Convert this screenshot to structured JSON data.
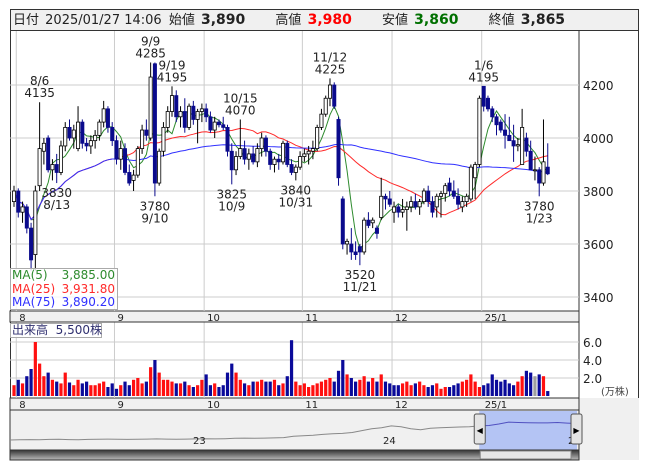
{
  "header": {
    "date_label": "日付",
    "datetime": "2025/01/27 14:06",
    "open_label": "始値",
    "open": "3,890",
    "high_label": "高値",
    "high": "3,980",
    "low_label": "安値",
    "low": "3,860",
    "close_label": "終値",
    "close": "3,865"
  },
  "ma_legend": [
    {
      "label": "MA(5)",
      "value": "3,885.00",
      "color": "#2e8b2e"
    },
    {
      "label": "MA(25)",
      "value": "3,931.80",
      "color": "#ff2a2a"
    },
    {
      "label": "MA(75)",
      "value": "3,890.20",
      "color": "#3030ff"
    }
  ],
  "volume_legend": {
    "label": "出来高",
    "value": "5,500株"
  },
  "colors": {
    "up_body": "#ffffff",
    "down_body": "#0a0a8c",
    "vol_up": "#ff1010",
    "vol_down": "#0a0a9a",
    "vol_flat": "#a0a0a0",
    "ma5": "#2e8b2e",
    "ma25": "#ff2a2a",
    "ma75": "#3030ff",
    "selection": "#b4c4f4"
  },
  "chart_data": {
    "type": "candlestick",
    "price_axis": {
      "ticks": [
        4200,
        4000,
        3800,
        3600,
        3400
      ],
      "labels": [
        "4200",
        "4000",
        "3800",
        "3600",
        "3400"
      ]
    },
    "volume_axis": {
      "ticks": [
        6,
        4,
        2
      ],
      "labels": [
        "6.0",
        "4.0",
        "2.0"
      ],
      "unit": "(万株)"
    },
    "month_ticks": [
      {
        "index": 1,
        "label": "8"
      },
      {
        "index": 24,
        "label": "9"
      },
      {
        "index": 45,
        "label": "10"
      },
      {
        "index": 68,
        "label": "11"
      },
      {
        "index": 89,
        "label": "12"
      },
      {
        "index": 110,
        "label": "25/1"
      }
    ],
    "ohlc": [
      [
        3760,
        3820,
        3740,
        3800
      ],
      [
        3800,
        3810,
        3700,
        3720
      ],
      [
        3720,
        3760,
        3680,
        3740
      ],
      [
        3740,
        3750,
        3640,
        3660
      ],
      [
        3660,
        3680,
        3500,
        3540
      ],
      [
        3560,
        3820,
        3500,
        3800
      ],
      [
        3820,
        4135,
        3800,
        3960
      ],
      [
        3950,
        4000,
        3900,
        3980
      ],
      [
        4000,
        4010,
        3870,
        3880
      ],
      [
        3880,
        3920,
        3840,
        3900
      ],
      [
        3900,
        3940,
        3830,
        3870
      ],
      [
        3870,
        3990,
        3860,
        3970
      ],
      [
        3970,
        4060,
        3950,
        4040
      ],
      [
        4040,
        4070,
        3990,
        4000
      ],
      [
        4000,
        4050,
        3960,
        4030
      ],
      [
        3960,
        4120,
        3950,
        4060
      ],
      [
        4060,
        4070,
        3960,
        3980
      ],
      [
        3980,
        4000,
        3950,
        3970
      ],
      [
        3970,
        4010,
        3940,
        3990
      ],
      [
        3990,
        4030,
        3960,
        4010
      ],
      [
        4010,
        4070,
        3990,
        4060
      ],
      [
        4060,
        4140,
        4040,
        4110
      ],
      [
        4110,
        4120,
        4020,
        4040
      ],
      [
        4040,
        4060,
        3970,
        3990
      ],
      [
        3990,
        4010,
        3900,
        3920
      ],
      [
        3920,
        3990,
        3880,
        3960
      ],
      [
        3960,
        3980,
        3860,
        3870
      ],
      [
        3870,
        3900,
        3820,
        3830
      ],
      [
        3840,
        3880,
        3800,
        3860
      ],
      [
        3860,
        3970,
        3850,
        3960
      ],
      [
        3960,
        4050,
        3940,
        4030
      ],
      [
        4030,
        4070,
        3990,
        4010
      ],
      [
        4000,
        4285,
        3990,
        4230
      ],
      [
        4280,
        4285,
        3780,
        3830
      ],
      [
        3830,
        3960,
        3820,
        3950
      ],
      [
        3950,
        4060,
        3930,
        4040
      ],
      [
        4040,
        4120,
        4020,
        4100
      ],
      [
        4100,
        4195,
        4080,
        4160
      ],
      [
        4160,
        4180,
        4060,
        4080
      ],
      [
        4080,
        4120,
        4040,
        4100
      ],
      [
        4100,
        4150,
        4020,
        4040
      ],
      [
        4040,
        4130,
        4030,
        4120
      ],
      [
        4120,
        4140,
        4050,
        4070
      ],
      [
        4070,
        4110,
        3980,
        4100
      ],
      [
        4100,
        4130,
        4060,
        4110
      ],
      [
        4110,
        4130,
        4060,
        4080
      ],
      [
        4080,
        4100,
        4020,
        4030
      ],
      [
        4030,
        4080,
        4000,
        4060
      ],
      [
        4060,
        4070,
        4040,
        4050
      ],
      [
        4050,
        4080,
        4030,
        4040
      ],
      [
        4040,
        4050,
        3930,
        3950
      ],
      [
        3950,
        3980,
        3825,
        3880
      ],
      [
        3880,
        3950,
        3860,
        3930
      ],
      [
        3930,
        4070,
        3920,
        3960
      ],
      [
        3960,
        3990,
        3900,
        3920
      ],
      [
        3920,
        3960,
        3880,
        3940
      ],
      [
        3940,
        3970,
        3900,
        3910
      ],
      [
        3910,
        3980,
        3890,
        3960
      ],
      [
        3960,
        4020,
        3930,
        4000
      ],
      [
        4000,
        4010,
        3930,
        3950
      ],
      [
        3950,
        3960,
        3880,
        3900
      ],
      [
        3900,
        3930,
        3870,
        3920
      ],
      [
        3920,
        3940,
        3880,
        3910
      ],
      [
        3910,
        3990,
        3900,
        3980
      ],
      [
        3980,
        3990,
        3890,
        3900
      ],
      [
        3900,
        3920,
        3860,
        3870
      ],
      [
        3870,
        3900,
        3840,
        3890
      ],
      [
        3890,
        3950,
        3880,
        3930
      ],
      [
        3930,
        3960,
        3910,
        3940
      ],
      [
        3940,
        3970,
        3900,
        3950
      ],
      [
        3950,
        3990,
        3920,
        3960
      ],
      [
        3960,
        4050,
        3950,
        4040
      ],
      [
        4040,
        4110,
        4030,
        4090
      ],
      [
        4090,
        4160,
        4080,
        4150
      ],
      [
        4150,
        4225,
        4120,
        4200
      ],
      [
        4200,
        4210,
        4110,
        4120
      ],
      [
        4070,
        4080,
        3820,
        3850
      ],
      [
        3770,
        3780,
        3580,
        3600
      ],
      [
        3600,
        3620,
        3560,
        3610
      ],
      [
        3600,
        3660,
        3540,
        3570
      ],
      [
        3570,
        3610,
        3540,
        3560
      ],
      [
        3590,
        3600,
        3520,
        3570
      ],
      [
        3570,
        3700,
        3560,
        3690
      ],
      [
        3690,
        3720,
        3660,
        3670
      ],
      [
        3680,
        3700,
        3660,
        3690
      ],
      [
        3660,
        3670,
        3620,
        3640
      ],
      [
        3700,
        3850,
        3690,
        3780
      ],
      [
        3780,
        3790,
        3730,
        3770
      ],
      [
        3770,
        3800,
        3740,
        3750
      ],
      [
        3720,
        3760,
        3680,
        3740
      ],
      [
        3740,
        3750,
        3700,
        3720
      ],
      [
        3720,
        3770,
        3700,
        3730
      ],
      [
        3730,
        3760,
        3650,
        3740
      ],
      [
        3740,
        3780,
        3720,
        3760
      ],
      [
        3760,
        3790,
        3730,
        3740
      ],
      [
        3740,
        3770,
        3710,
        3760
      ],
      [
        3760,
        3810,
        3750,
        3800
      ],
      [
        3800,
        3820,
        3740,
        3760
      ],
      [
        3760,
        3780,
        3700,
        3720
      ],
      [
        3740,
        3790,
        3700,
        3780
      ],
      [
        3780,
        3800,
        3700,
        3790
      ],
      [
        3790,
        3830,
        3760,
        3820
      ],
      [
        3830,
        3850,
        3780,
        3800
      ],
      [
        3800,
        3840,
        3770,
        3780
      ],
      [
        3780,
        3810,
        3730,
        3750
      ],
      [
        3740,
        3780,
        3720,
        3760
      ],
      [
        3760,
        3790,
        3740,
        3780
      ],
      [
        3770,
        3900,
        3760,
        3890
      ],
      [
        3850,
        3910,
        3770,
        3900
      ],
      [
        3900,
        4160,
        3890,
        4150
      ],
      [
        4195,
        4195,
        4100,
        4120
      ],
      [
        4150,
        4160,
        4100,
        4110
      ],
      [
        4110,
        4120,
        4060,
        4080
      ],
      [
        4080,
        4090,
        4010,
        4050
      ],
      [
        4060,
        4070,
        4020,
        4030
      ],
      [
        4030,
        4090,
        3960,
        4010
      ],
      [
        4010,
        4080,
        3990,
        3990
      ],
      [
        3990,
        4050,
        3910,
        3970
      ],
      [
        3970,
        4000,
        3950,
        3975
      ],
      [
        3900,
        4110,
        3900,
        4040
      ],
      [
        4000,
        4020,
        3930,
        3950
      ],
      [
        3950,
        3990,
        3880,
        3880
      ],
      [
        3880,
        3930,
        3840,
        3880
      ],
      [
        3880,
        3890,
        3780,
        3830
      ],
      [
        3830,
        4070,
        3820,
        3910
      ],
      [
        3890,
        3980,
        3860,
        3865
      ]
    ],
    "volume": [
      1.2,
      1.8,
      1.4,
      2.2,
      3.0,
      6.0,
      3.6,
      2.2,
      2.6,
      1.8,
      1.6,
      1.4,
      2.6,
      1.5,
      1.2,
      1.8,
      1.4,
      1.6,
      1.2,
      1.2,
      1.4,
      1.6,
      1.0,
      1.4,
      0.8,
      1.2,
      1.6,
      1.2,
      1.8,
      2.0,
      1.4,
      1.6,
      3.2,
      4.0,
      2.6,
      1.8,
      1.8,
      1.6,
      1.4,
      1.4,
      1.6,
      1.2,
      1.0,
      1.2,
      1.8,
      2.4,
      1.2,
      1.4,
      1.0,
      1.2,
      2.6,
      3.6,
      2.6,
      1.8,
      1.4,
      1.2,
      1.6,
      1.6,
      1.8,
      1.6,
      1.6,
      1.8,
      1.2,
      1.4,
      2.2,
      6.2,
      1.6,
      1.2,
      1.4,
      1.0,
      1.2,
      1.4,
      1.6,
      1.8,
      2.0,
      1.6,
      2.8,
      4.0,
      2.4,
      2.0,
      1.6,
      1.8,
      2.2,
      1.6,
      2.0,
      1.6,
      2.4,
      1.6,
      1.4,
      1.2,
      1.2,
      1.4,
      1.6,
      1.2,
      1.4,
      1.6,
      1.2,
      1.0,
      1.2,
      1.4,
      0.8,
      1.0,
      1.0,
      1.2,
      1.4,
      1.6,
      1.8,
      2.4,
      1.6,
      1.0,
      1.2,
      1.4,
      2.4,
      1.8,
      1.6,
      1.8,
      1.4,
      1.2,
      1.6,
      2.2,
      2.8,
      2.6,
      2.2,
      2.4,
      2.2,
      0.55
    ],
    "annotations": [
      {
        "index": 6,
        "value": "4135",
        "date": "8/6",
        "position": "above"
      },
      {
        "index": 10,
        "value": "3830",
        "date": "8/13",
        "position": "below"
      },
      {
        "index": 32,
        "value": "4285",
        "date": "9/9",
        "position": "above"
      },
      {
        "index": 33,
        "value": "3780",
        "date": "9/10",
        "position": "below"
      },
      {
        "index": 37,
        "value": "4195",
        "date": "9/19",
        "position": "above"
      },
      {
        "index": 51,
        "value": "3825",
        "date": "10/9",
        "position": "below"
      },
      {
        "index": 53,
        "value": "4070",
        "date": "10/15",
        "position": "above"
      },
      {
        "index": 66,
        "value": "3840",
        "date": "10/31",
        "position": "below"
      },
      {
        "index": 74,
        "value": "4225",
        "date": "11/12",
        "position": "above"
      },
      {
        "index": 81,
        "value": "3520",
        "date": "11/21",
        "position": "below"
      },
      {
        "index": 110,
        "value": "4195",
        "date": "1/6",
        "position": "above"
      },
      {
        "index": 123,
        "value": "3780",
        "date": "1/23",
        "position": "below"
      }
    ],
    "moving_averages": [
      5,
      25,
      75
    ],
    "navigator": {
      "year_labels": [
        "23",
        "24",
        "2"
      ],
      "overview": [
        2950,
        2960,
        2970,
        2960,
        2980,
        2990,
        2970,
        2960,
        2980,
        2990,
        3000,
        2990,
        2980,
        2990,
        3000,
        3010,
        3000,
        2990,
        3000,
        3010,
        3020,
        3010,
        3020,
        3040,
        3050,
        3040,
        3050,
        3060,
        3080,
        3150,
        3180,
        3200,
        3250,
        3280,
        3300,
        3350,
        3450,
        3550,
        3600,
        3700,
        3650,
        3550,
        3500,
        3580,
        3600,
        3620,
        3640,
        3660,
        3700,
        3720,
        3800,
        3900,
        3880,
        3870,
        3860,
        3860,
        3880,
        3850,
        3830
      ]
    }
  }
}
